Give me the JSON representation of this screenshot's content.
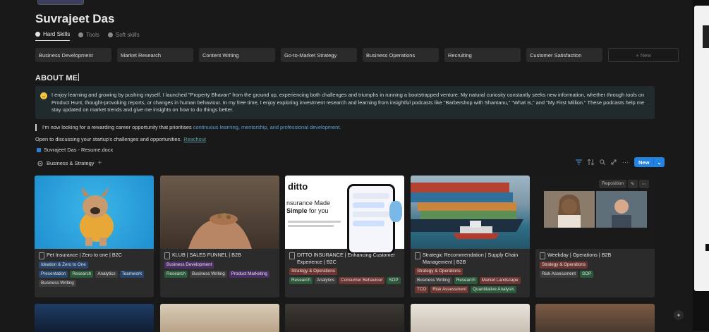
{
  "page": {
    "title": "Suvrajeet Das",
    "tabs": [
      {
        "label": "Hard Skills",
        "active": true
      },
      {
        "label": "Tools",
        "active": false
      },
      {
        "label": "Soft skills",
        "active": false
      }
    ],
    "skills": [
      "Business Development",
      "Market Research",
      "Content Writing",
      "Go-to-Market Strategy",
      "Business Operations",
      "Recruiting",
      "Customer Satisfaction"
    ],
    "new_label": "+ New"
  },
  "about": {
    "heading": "ABOUT ME",
    "callout": "I enjoy learning and growing by pushing myself. I launched \"Property Bhavan\" from the ground up, experiencing both challenges and triumphs in running a bootstrapped venture. My natural curiosity constantly seeks new information, whether through tools on Product Hunt, thought-provoking reports, or changes in human behaviour. In my free time, I enjoy exploring investment research and learning from insightful podcasts like \"Barbershop with Shantanu,\" \"What Is,\" and \"My First Million.\" These podcasts help me stay updated on market trends and give me insights on how to do things better.",
    "quote_text": "I'm now looking for a rewarding career opportunity that prioritises ",
    "quote_link": "continuous learning, mentorship, and professional development.",
    "discuss_text": "Open to discussing your startup's challenges and opportunities.",
    "reachout": "Reachout",
    "file": "Suvrajeet Das - Resume.docx"
  },
  "database": {
    "title": "Business & Strategy",
    "new_button": "New",
    "reposition": "Reposition",
    "cover_texts": {
      "ditto_logo": "ditto",
      "ditto_heading_1": "nsurance Made",
      "ditto_heading_2": "Simple",
      "ditto_heading_3": " for you"
    },
    "cards": [
      {
        "title": "Pet Insurance | Zero to one | B2C",
        "tags": [
          [
            "Ideation & Zero to One",
            "blue"
          ],
          [
            "Presentation",
            "blue"
          ],
          [
            "Research",
            "green"
          ],
          [
            "Analytics",
            "gray"
          ],
          [
            "Teamwork",
            "blue"
          ],
          [
            "Business Writing",
            "gray"
          ]
        ]
      },
      {
        "title": "KLUB | SALES FUNNEL | B2B",
        "tags": [
          [
            "Business Development",
            "purple"
          ],
          [
            "Research",
            "green"
          ],
          [
            "Business Writing",
            "gray"
          ],
          [
            "Product Marketing",
            "purple"
          ]
        ]
      },
      {
        "title": "DITTO INSURANCE | Enhancing Customer Experience | B2C",
        "tags": [
          [
            "Strategy & Operations",
            "red"
          ],
          [
            "Research",
            "green"
          ],
          [
            "Analytics",
            "gray"
          ],
          [
            "Consumer Behaviour",
            "red"
          ],
          [
            "SOP",
            "green"
          ]
        ]
      },
      {
        "title": "Strategic Recommendation | Supply Chain Management | B2B",
        "tags": [
          [
            "Strategy & Operations",
            "red"
          ],
          [
            "Business Writing",
            "gray"
          ],
          [
            "Research",
            "green"
          ],
          [
            "Market Landscape",
            "red"
          ],
          [
            "TCO",
            "red"
          ],
          [
            "Risk Assessment",
            "red"
          ],
          [
            "Quantitative Analysis",
            "green"
          ]
        ]
      },
      {
        "title": "Weekday | Operations | B2B",
        "tags": [
          [
            "Strategy & Operations",
            "red"
          ],
          [
            "Risk Assessment",
            "gray"
          ],
          [
            "SOP",
            "green"
          ]
        ]
      }
    ]
  },
  "colors": {
    "accent": "#2383e2",
    "background": "#191919",
    "callout": "#212b2e"
  },
  "icons": [
    "page-icon",
    "target-icon",
    "filter-icon",
    "sort-icon",
    "search-icon",
    "expand-icon",
    "more-icon"
  ]
}
